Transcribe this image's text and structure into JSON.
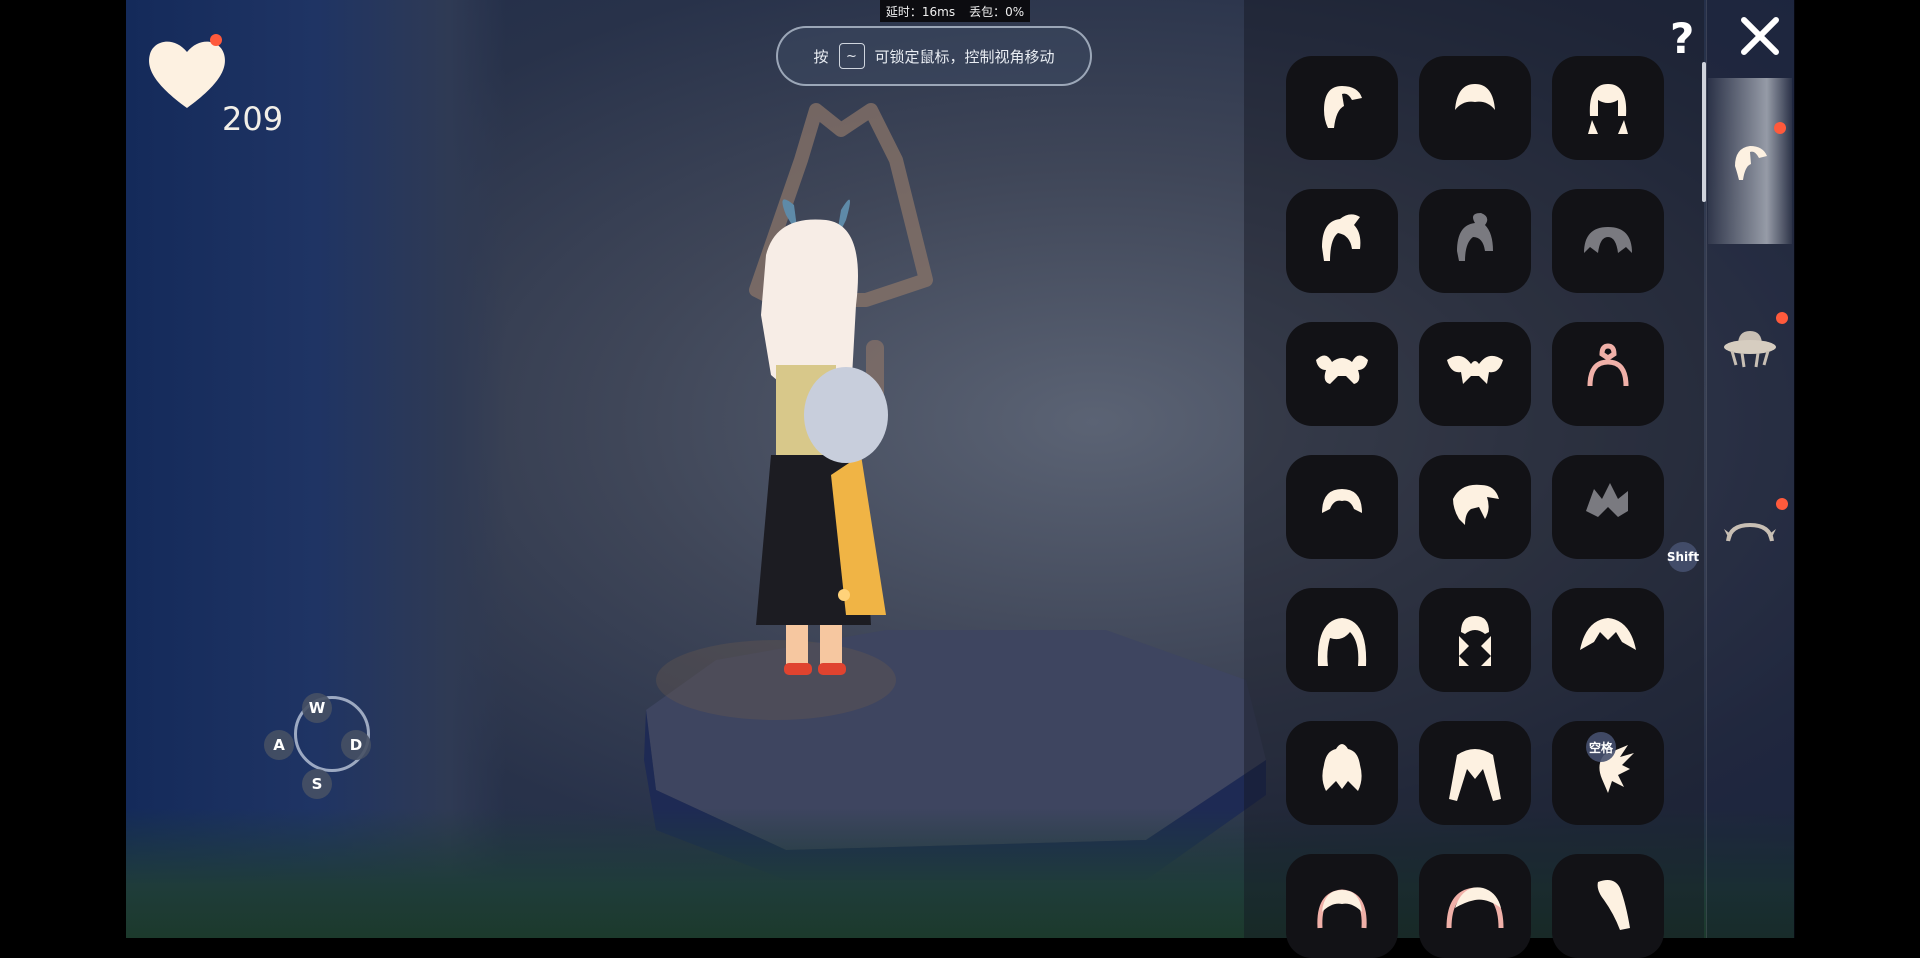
{
  "hud": {
    "heart_count": "209",
    "net_latency": "延时：16ms",
    "net_loss": "丢包：0%",
    "hint_prefix": "按",
    "hint_key": "~",
    "hint_suffix": "可锁定鼠标，控制视角移动",
    "help_label": "?"
  },
  "controls": {
    "up": "W",
    "left": "A",
    "right": "D",
    "down": "S",
    "shift": "Shift",
    "space": "空格"
  },
  "closet": {
    "category_tabs": [
      {
        "icon": "hair-icon",
        "active": true,
        "notification": true
      },
      {
        "icon": "hat-icon",
        "active": false,
        "notification": true
      },
      {
        "icon": "horns-icon",
        "active": false,
        "notification": true
      }
    ],
    "hair_items": [
      {
        "icon": "hair-sidetail-icon",
        "locked": false
      },
      {
        "icon": "hair-short-icon",
        "locked": false
      },
      {
        "icon": "hair-pigtails-icon",
        "locked": false
      },
      {
        "icon": "hair-ponytail-icon",
        "locked": false
      },
      {
        "icon": "hair-bun-icon",
        "locked": true
      },
      {
        "icon": "hair-twin-bun-icon",
        "locked": true
      },
      {
        "icon": "hair-pom-pom-icon",
        "locked": false
      },
      {
        "icon": "hair-bow-icon",
        "locked": false
      },
      {
        "icon": "hair-headband-icon",
        "locked": true
      },
      {
        "icon": "hair-bowl-icon",
        "locked": false
      },
      {
        "icon": "hair-swoop-icon",
        "locked": false
      },
      {
        "icon": "hair-spiky-icon",
        "locked": true
      },
      {
        "icon": "hair-bob-icon",
        "locked": false
      },
      {
        "icon": "hair-braids-icon",
        "locked": false
      },
      {
        "icon": "hair-pointed-icon",
        "locked": false
      },
      {
        "icon": "hair-topknot-icon",
        "locked": false
      },
      {
        "icon": "hair-long-icon",
        "locked": false
      },
      {
        "icon": "hair-flame-icon",
        "locked": false
      },
      {
        "icon": "hair-band-icon",
        "locked": false
      },
      {
        "icon": "hair-long-band-icon",
        "locked": false
      },
      {
        "icon": "hair-side-sweep-icon",
        "locked": false
      }
    ]
  },
  "colors": {
    "notification": "#ff5a3c",
    "icon_cream": "#fdf1e1",
    "icon_locked": "#7a7a80",
    "slot_bg": "#121216"
  }
}
